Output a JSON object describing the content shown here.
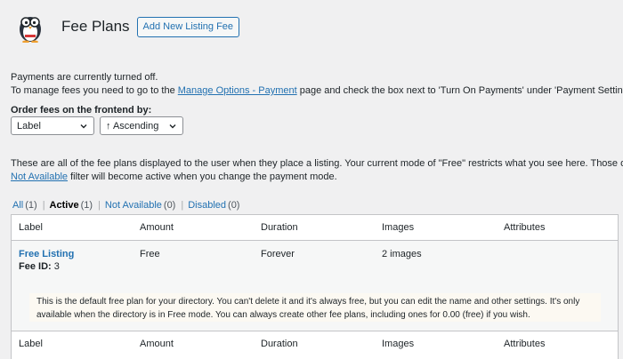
{
  "header": {
    "title": "Fee Plans",
    "add_button": "Add New Listing Fee"
  },
  "notice": {
    "line1": "Payments are currently turned off.",
    "line2_prefix": "To manage fees you need to go to the",
    "line2_link": "Manage Options - Payment",
    "line2_suffix": "page and check the box next to 'Turn On Payments' under 'Payment Settings'."
  },
  "order": {
    "label": "Order fees on the frontend by:",
    "field_value": "Label",
    "direction_value": "↑ Ascending"
  },
  "description": {
    "line1": "These are all of the fee plans displayed to the user when they place a listing. Your current mode of \"Free\" restricts what you see here. Those on the",
    "line2_link": "Not Available",
    "line2_suffix": "filter will become active when you change the payment mode."
  },
  "filters": [
    {
      "label": "All",
      "count": "(1)",
      "current": false
    },
    {
      "label": "Active",
      "count": "(1)",
      "current": true
    },
    {
      "label": "Not Available",
      "count": "(0)",
      "current": false
    },
    {
      "label": "Disabled",
      "count": "(0)",
      "current": false
    }
  ],
  "table": {
    "columns": [
      "Label",
      "Amount",
      "Duration",
      "Images",
      "Attributes"
    ],
    "rows": [
      {
        "label": "Free Listing",
        "fee_id_label": "Fee ID:",
        "fee_id": "3",
        "amount": "Free",
        "duration": "Forever",
        "images": "2 images",
        "attributes": "",
        "note_line1": "This is the default free plan for your directory. You can't delete it and it's always free, but you can edit the name and other settings. It's only",
        "note_line2": "available when the directory is in Free mode. You can always create other fee plans, including ones for 0.00 (free) if you wish."
      }
    ]
  },
  "colors": {
    "link": "#2271b1",
    "background": "#f0f0f1",
    "note_background": "#fcf9f2"
  }
}
